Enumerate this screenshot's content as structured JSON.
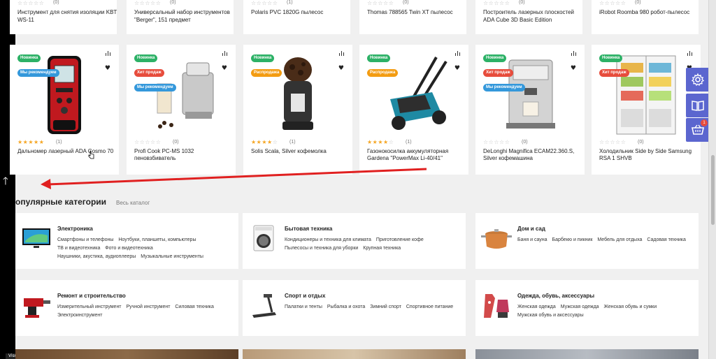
{
  "top_row": [
    {
      "rating_count": "(0)",
      "name": "Инструмент для снятия изоляции KBT WS-11"
    },
    {
      "rating_count": "(0)",
      "name": "Универсальный набор инструментов \"Berger\", 151 предмет"
    },
    {
      "rating_count": "(1)",
      "name": "Polaris PVC 1820G пылесос"
    },
    {
      "rating_count": "(0)",
      "name": "Thomas 788565 Twin XT пылесос"
    },
    {
      "rating_count": "(0)",
      "name": "Построитель лазерных плоскостей ADA Cube 3D Basic Edition"
    },
    {
      "rating_count": "(0)",
      "name": "iRobot Roomba 980 робот-пылесос"
    }
  ],
  "products": [
    {
      "badges": [
        {
          "label": "Новинка",
          "type": "new"
        },
        {
          "label": "Мы рекомендуем",
          "type": "rec"
        }
      ],
      "rating": 5,
      "rating_count": "(1)",
      "name": "Дальномер лазерный ADA Cosmo 70"
    },
    {
      "badges": [
        {
          "label": "Новинка",
          "type": "new"
        },
        {
          "label": "Хит продаж",
          "type": "hit"
        },
        {
          "label": "Мы рекомендуем",
          "type": "rec"
        }
      ],
      "rating": 0,
      "rating_count": "(0)",
      "name": "Profi Cook PC-MS 1032 пеновзбиватель"
    },
    {
      "badges": [
        {
          "label": "Новинка",
          "type": "new"
        },
        {
          "label": "Распродажа",
          "type": "sale"
        }
      ],
      "rating": 4,
      "rating_count": "(1)",
      "name": "Solis Scala, Silver кофемолка"
    },
    {
      "badges": [
        {
          "label": "Новинка",
          "type": "new"
        },
        {
          "label": "Распродажа",
          "type": "sale"
        }
      ],
      "rating": 4,
      "rating_count": "(1)",
      "name": "Газонокосилка аккумуляторная Gardena \"PowerMax Li-40/41\""
    },
    {
      "badges": [
        {
          "label": "Новинка",
          "type": "new"
        },
        {
          "label": "Хит продаж",
          "type": "hit"
        },
        {
          "label": "Мы рекомендуем",
          "type": "rec"
        }
      ],
      "rating": 0,
      "rating_count": "(0)",
      "name": "DeLonghi Magnifica ECAM22.360.S, Silver кофемашина"
    },
    {
      "badges": [
        {
          "label": "Новинка",
          "type": "new"
        },
        {
          "label": "Хит продаж",
          "type": "hit"
        }
      ],
      "rating": 0,
      "rating_count": "(0)",
      "name": "Холодильник Side by Side Samsung RSA 1 SHVB"
    }
  ],
  "section": {
    "title": "опулярные категории",
    "catalog_link": "Весь каталог"
  },
  "categories": [
    {
      "title": "Электроника",
      "icon": "tv-icon",
      "links": [
        "Смартфоны и телефоны",
        "Ноутбуки, планшеты, компьютеры",
        "ТВ и видеотехника",
        "Фото и видеотехника",
        "Наушники, акустика, аудиоплееры",
        "Музыкальные инструменты"
      ]
    },
    {
      "title": "Бытовая техника",
      "icon": "washing-machine-icon",
      "links": [
        "Кондиционеры и техника для климата",
        "Приготовление кофе",
        "Пылесосы и техника для уборки",
        "Крупная техника"
      ]
    },
    {
      "title": "Дом и сад",
      "icon": "pot-icon",
      "links": [
        "Баня и сауна",
        "Барбекю и пикник",
        "Мебель для отдыха",
        "Садовая техника"
      ]
    },
    {
      "title": "Ремонт и строительство",
      "icon": "drill-icon",
      "links": [
        "Измерительный инструмент",
        "Ручной инструмент",
        "Силовая техника",
        "Электроинструмент"
      ]
    },
    {
      "title": "Спорт и отдых",
      "icon": "treadmill-icon",
      "links": [
        "Палатки и тенты",
        "Рыбалка и охота",
        "Зимний спорт",
        "Спортивное питание"
      ]
    },
    {
      "title": "Одежда, обувь, аксессуары",
      "icon": "clothes-icon",
      "links": [
        "Женская одежда",
        "Мужская одежда",
        "Женская обувь и сумки",
        "Мужская обувь и аксессуары"
      ]
    }
  ],
  "side_panel": {
    "cart_count": "1",
    "buttons": [
      "gear-icon",
      "book-icon",
      "cart-icon"
    ]
  },
  "overlay": {
    "up_arrow": "🡑",
    "vscode_label": "Visual Studio Code"
  },
  "stars": {
    "filled": "★★★★★",
    "empty": "☆☆☆☆☆"
  },
  "colors": {
    "accent": "#5b66cf",
    "new": "#2cb166",
    "hit": "#e74c3c",
    "rec": "#3498db",
    "sale": "#f39c12",
    "star": "#f5a623",
    "arrow": "#e02020"
  }
}
